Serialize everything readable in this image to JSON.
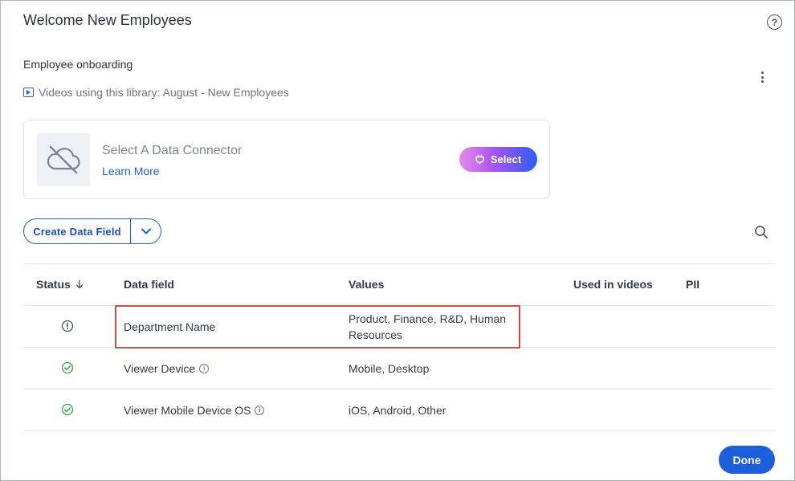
{
  "dialog": {
    "title": "Welcome New Employees",
    "help_icon": "question-circle-icon"
  },
  "library": {
    "name": "Employee onboarding",
    "videos_text": "Videos using this library: August - New Employees"
  },
  "connector": {
    "title": "Select A Data Connector",
    "learn_more": "Learn More",
    "select_label": "Select",
    "icon": "cloud-off-icon"
  },
  "toolbar": {
    "create_label": "Create Data Field"
  },
  "table": {
    "headers": {
      "status": "Status",
      "data_field": "Data field",
      "values": "Values",
      "used_in_videos": "Used in videos",
      "pii": "PII"
    },
    "rows": [
      {
        "status": "warning",
        "field": "Department Name",
        "values": "Product, Finance, R&D, Human Resources"
      },
      {
        "status": "ok",
        "field": "Viewer Device",
        "values": "Mobile, Desktop"
      },
      {
        "status": "ok",
        "field": "Viewer Mobile Device OS",
        "values": "iOS, Android, Other"
      }
    ]
  },
  "footer": {
    "done_label": "Done"
  },
  "colors": {
    "primary": "#1e5fd9",
    "success": "#2aa84a",
    "highlight": "#d94a4a"
  }
}
